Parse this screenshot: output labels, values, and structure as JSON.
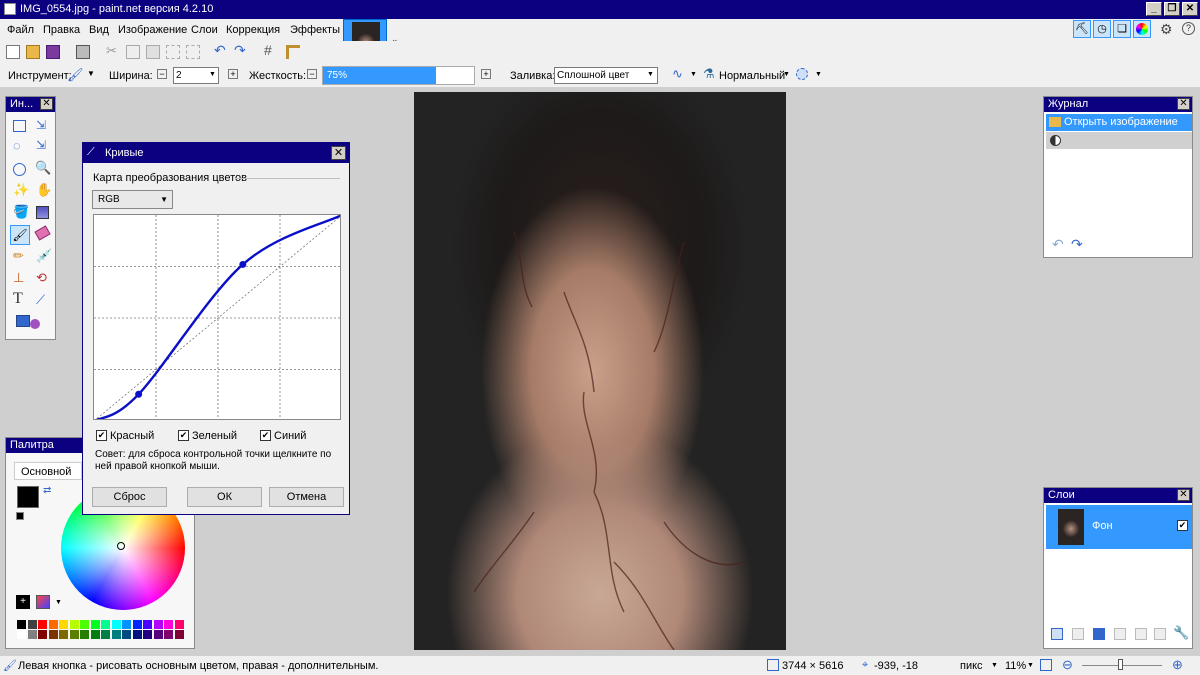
{
  "window": {
    "title": "IMG_0554.jpg - paint.net версия 4.2.10",
    "min": "_",
    "restore": "❐",
    "close": "✕"
  },
  "menu": [
    "Файл",
    "Правка",
    "Вид",
    "Изображение",
    "Слои",
    "Коррекция",
    "Эффекты"
  ],
  "toolbar": {
    "tool_label": "Инструмент:",
    "width_label": "Ширина:",
    "width_value": "2",
    "hardness_label": "Жесткость:",
    "hardness_value": "75%",
    "hardness_fraction": 0.75,
    "fill_label": "Заливка:",
    "fill_value": "Сплошной цвет",
    "blend_value": "Нормальный"
  },
  "tools": {
    "title": "Ин..."
  },
  "curves": {
    "title": "Кривые",
    "group_label": "Карта преобразования цветов",
    "mode": "RGB",
    "checks": [
      {
        "label": "Красный",
        "checked": true
      },
      {
        "label": "Зеленый",
        "checked": true
      },
      {
        "label": "Синий",
        "checked": true
      }
    ],
    "hint": "Совет: для сброса контрольной точки щелкните по ней правой кнопкой мыши.",
    "reset": "Сброс",
    "ok": "ОК",
    "cancel": "Отмена",
    "control_points": [
      [
        0,
        0
      ],
      [
        0.18,
        0.13
      ],
      [
        0.6,
        0.76
      ],
      [
        1,
        1
      ]
    ]
  },
  "palette": {
    "title": "Палитра",
    "mode": "Основной",
    "colors": [
      "#000000",
      "#404040",
      "#ff0000",
      "#ff6a00",
      "#ffd800",
      "#b6ff00",
      "#4cff00",
      "#00ff21",
      "#00ff90",
      "#00ffff",
      "#0094ff",
      "#0026ff",
      "#4800ff",
      "#b200ff",
      "#ff00dc",
      "#ff006e",
      "#ffffff",
      "#808080",
      "#7f0000",
      "#7f3300",
      "#7f6a00",
      "#5b7f00",
      "#267f00",
      "#007f0e",
      "#007f46",
      "#007f7f",
      "#004a7f",
      "#00137f",
      "#21007f",
      "#57007f",
      "#7f006e",
      "#7f0037"
    ]
  },
  "history": {
    "title": "Журнал",
    "items": [
      "Открыть изображение",
      ""
    ]
  },
  "layers": {
    "title": "Слои",
    "items": [
      {
        "name": "Фон",
        "visible": true
      }
    ]
  },
  "status": {
    "hint": "Левая кнопка - рисовать основным цветом, правая - дополнительным.",
    "size": "3744 × 5616",
    "cursor": "-939, -18",
    "units": "пикс",
    "zoom": "11%"
  }
}
